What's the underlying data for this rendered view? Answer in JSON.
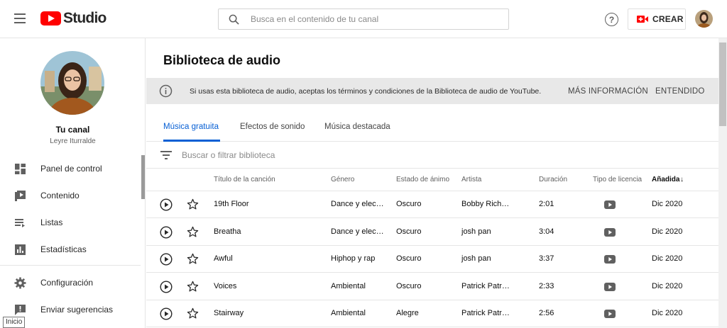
{
  "header": {
    "logo_text": "Studio",
    "search_placeholder": "Busca en el contenido de tu canal",
    "help_label": "?",
    "create_label": "CREAR"
  },
  "sidebar": {
    "channel_title": "Tu canal",
    "channel_name": "Leyre Iturralde",
    "items": [
      {
        "label": "Panel de control",
        "icon": "dashboard-icon"
      },
      {
        "label": "Contenido",
        "icon": "content-icon"
      },
      {
        "label": "Listas",
        "icon": "playlists-icon"
      },
      {
        "label": "Estadísticas",
        "icon": "analytics-icon"
      },
      {
        "label": "Configuración",
        "icon": "gear-icon"
      },
      {
        "label": "Enviar sugerencias",
        "icon": "feedback-icon"
      }
    ],
    "tooltip": "Inicio"
  },
  "main": {
    "title": "Biblioteca de audio",
    "banner": {
      "text": "Si usas esta biblioteca de audio, aceptas los términos y condiciones de la Biblioteca de audio de YouTube.",
      "more": "MÁS INFORMACIÓN",
      "ok": "ENTENDIDO"
    },
    "tabs": [
      {
        "label": "Música gratuita",
        "active": true
      },
      {
        "label": "Efectos de sonido",
        "active": false
      },
      {
        "label": "Música destacada",
        "active": false
      }
    ],
    "filter_placeholder": "Buscar o filtrar biblioteca",
    "columns": {
      "title": "Título de la canción",
      "genre": "Género",
      "mood": "Estado de ánimo",
      "artist": "Artista",
      "duration": "Duración",
      "license": "Tipo de licencia",
      "added": "Añadida",
      "added_sort": "↓"
    },
    "rows": [
      {
        "title": "19th Floor",
        "genre": "Dance y elec…",
        "mood": "Oscuro",
        "artist": "Bobby Rich…",
        "duration": "2:01",
        "added": "Dic 2020"
      },
      {
        "title": "Breatha",
        "genre": "Dance y elec…",
        "mood": "Oscuro",
        "artist": "josh pan",
        "duration": "3:04",
        "added": "Dic 2020"
      },
      {
        "title": "Awful",
        "genre": "Hiphop y rap",
        "mood": "Oscuro",
        "artist": "josh pan",
        "duration": "3:37",
        "added": "Dic 2020"
      },
      {
        "title": "Voices",
        "genre": "Ambiental",
        "mood": "Oscuro",
        "artist": "Patrick Patr…",
        "duration": "2:33",
        "added": "Dic 2020"
      },
      {
        "title": "Stairway",
        "genre": "Ambiental",
        "mood": "Alegre",
        "artist": "Patrick Patr…",
        "duration": "2:56",
        "added": "Dic 2020"
      }
    ]
  },
  "colors": {
    "brand_red": "#ff0000",
    "accent_blue": "#065fd4",
    "banner_bg": "#e8e8e8"
  }
}
